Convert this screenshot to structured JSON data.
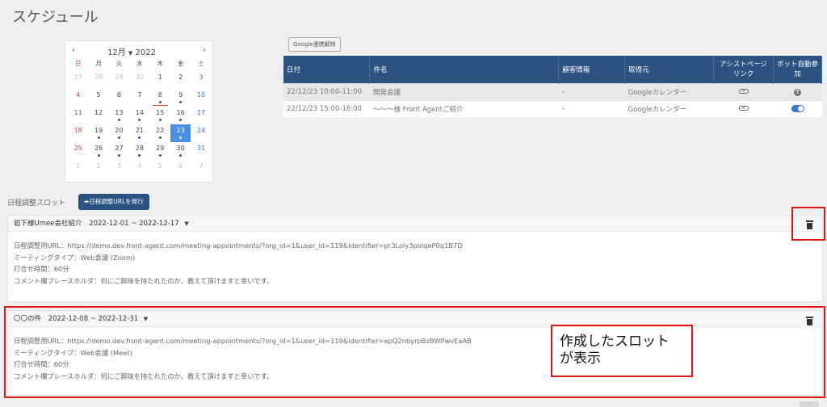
{
  "page": {
    "title": "スケジュール"
  },
  "calendar": {
    "month_label": "12月",
    "year_label": "2022",
    "weekdays": [
      "日",
      "月",
      "火",
      "水",
      "木",
      "金",
      "土"
    ],
    "weeks": [
      [
        "27",
        "28",
        "29",
        "30",
        "1",
        "2",
        "3"
      ],
      [
        "4",
        "5",
        "6",
        "7",
        "8",
        "9",
        "10"
      ],
      [
        "11",
        "12",
        "13",
        "14",
        "15",
        "16",
        "17"
      ],
      [
        "18",
        "19",
        "20",
        "21",
        "22",
        "23",
        "24"
      ],
      [
        "25",
        "26",
        "27",
        "28",
        "29",
        "30",
        "31"
      ],
      [
        "1",
        "2",
        "3",
        "4",
        "5",
        "6",
        "7"
      ]
    ],
    "today": "8",
    "selected": "23"
  },
  "google": {
    "unlink_label": "Google連携解除"
  },
  "schedule_table": {
    "headers": {
      "date": "日付",
      "subject": "件名",
      "customer": "顧客情報",
      "source": "取得元",
      "assist_link": "アシストページリンク",
      "bot_auto": "ボット自動参加"
    },
    "rows": [
      {
        "date": "22/12/23 10:00-11:00",
        "subject": "開発会議",
        "customer": "-",
        "source": "Googleカレンダー",
        "bot": "help"
      },
      {
        "date": "22/12/23 15:00-16:00",
        "subject": "〜〜〜様 Front Agentご紹介",
        "customer": "-",
        "source": "Googleカレンダー",
        "bot": "toggle-on"
      }
    ]
  },
  "slots": {
    "section_label": "日程調整スロット",
    "issue_button": "日程調整URLを発行",
    "items": [
      {
        "title": "岩下様Umee会社紹介",
        "range": "2022-12-01 ~ 2022-12-17",
        "url_line": "日程調整用URL：https://demo.dev.front-agent.com/meeting-appointments/?org_id=1&user_id=119&identifier=pr3Loly3polqeP0q1B7D",
        "type_line": "ミーティングタイプ：Web会議 (Zoom)",
        "time_line": "打合せ時間：60分",
        "comment_line": "コメント欄プレースホルダ：何にご興味を持たれたのか、教えて頂けますと幸いです。"
      },
      {
        "title": "〇〇の件",
        "range": "2022-12-08 ~ 2022-12-31",
        "url_line": "日程調整用URL：https://demo.dev.front-agent.com/meeting-appointments/?org_id=1&user_id=119&identifier=epQ2nbyrpBzBWPwvEaAB",
        "type_line": "ミーティングタイプ：Web会議 (Meet)",
        "time_line": "打合せ時間：60分",
        "comment_line": "コメント欄プレースホルダ：何にご興味を持たれたのか、教えて頂けますと幸いです。"
      }
    ]
  },
  "annotation": {
    "line1": "作成したスロット",
    "line2": "が表示"
  },
  "icons": {
    "trash": "trash-icon",
    "link": "link-icon",
    "help": "help-icon",
    "share": "share-icon"
  },
  "colors": {
    "accent": "#2c5282",
    "annotation": "#e01515",
    "selected_day": "#4a90e2"
  }
}
